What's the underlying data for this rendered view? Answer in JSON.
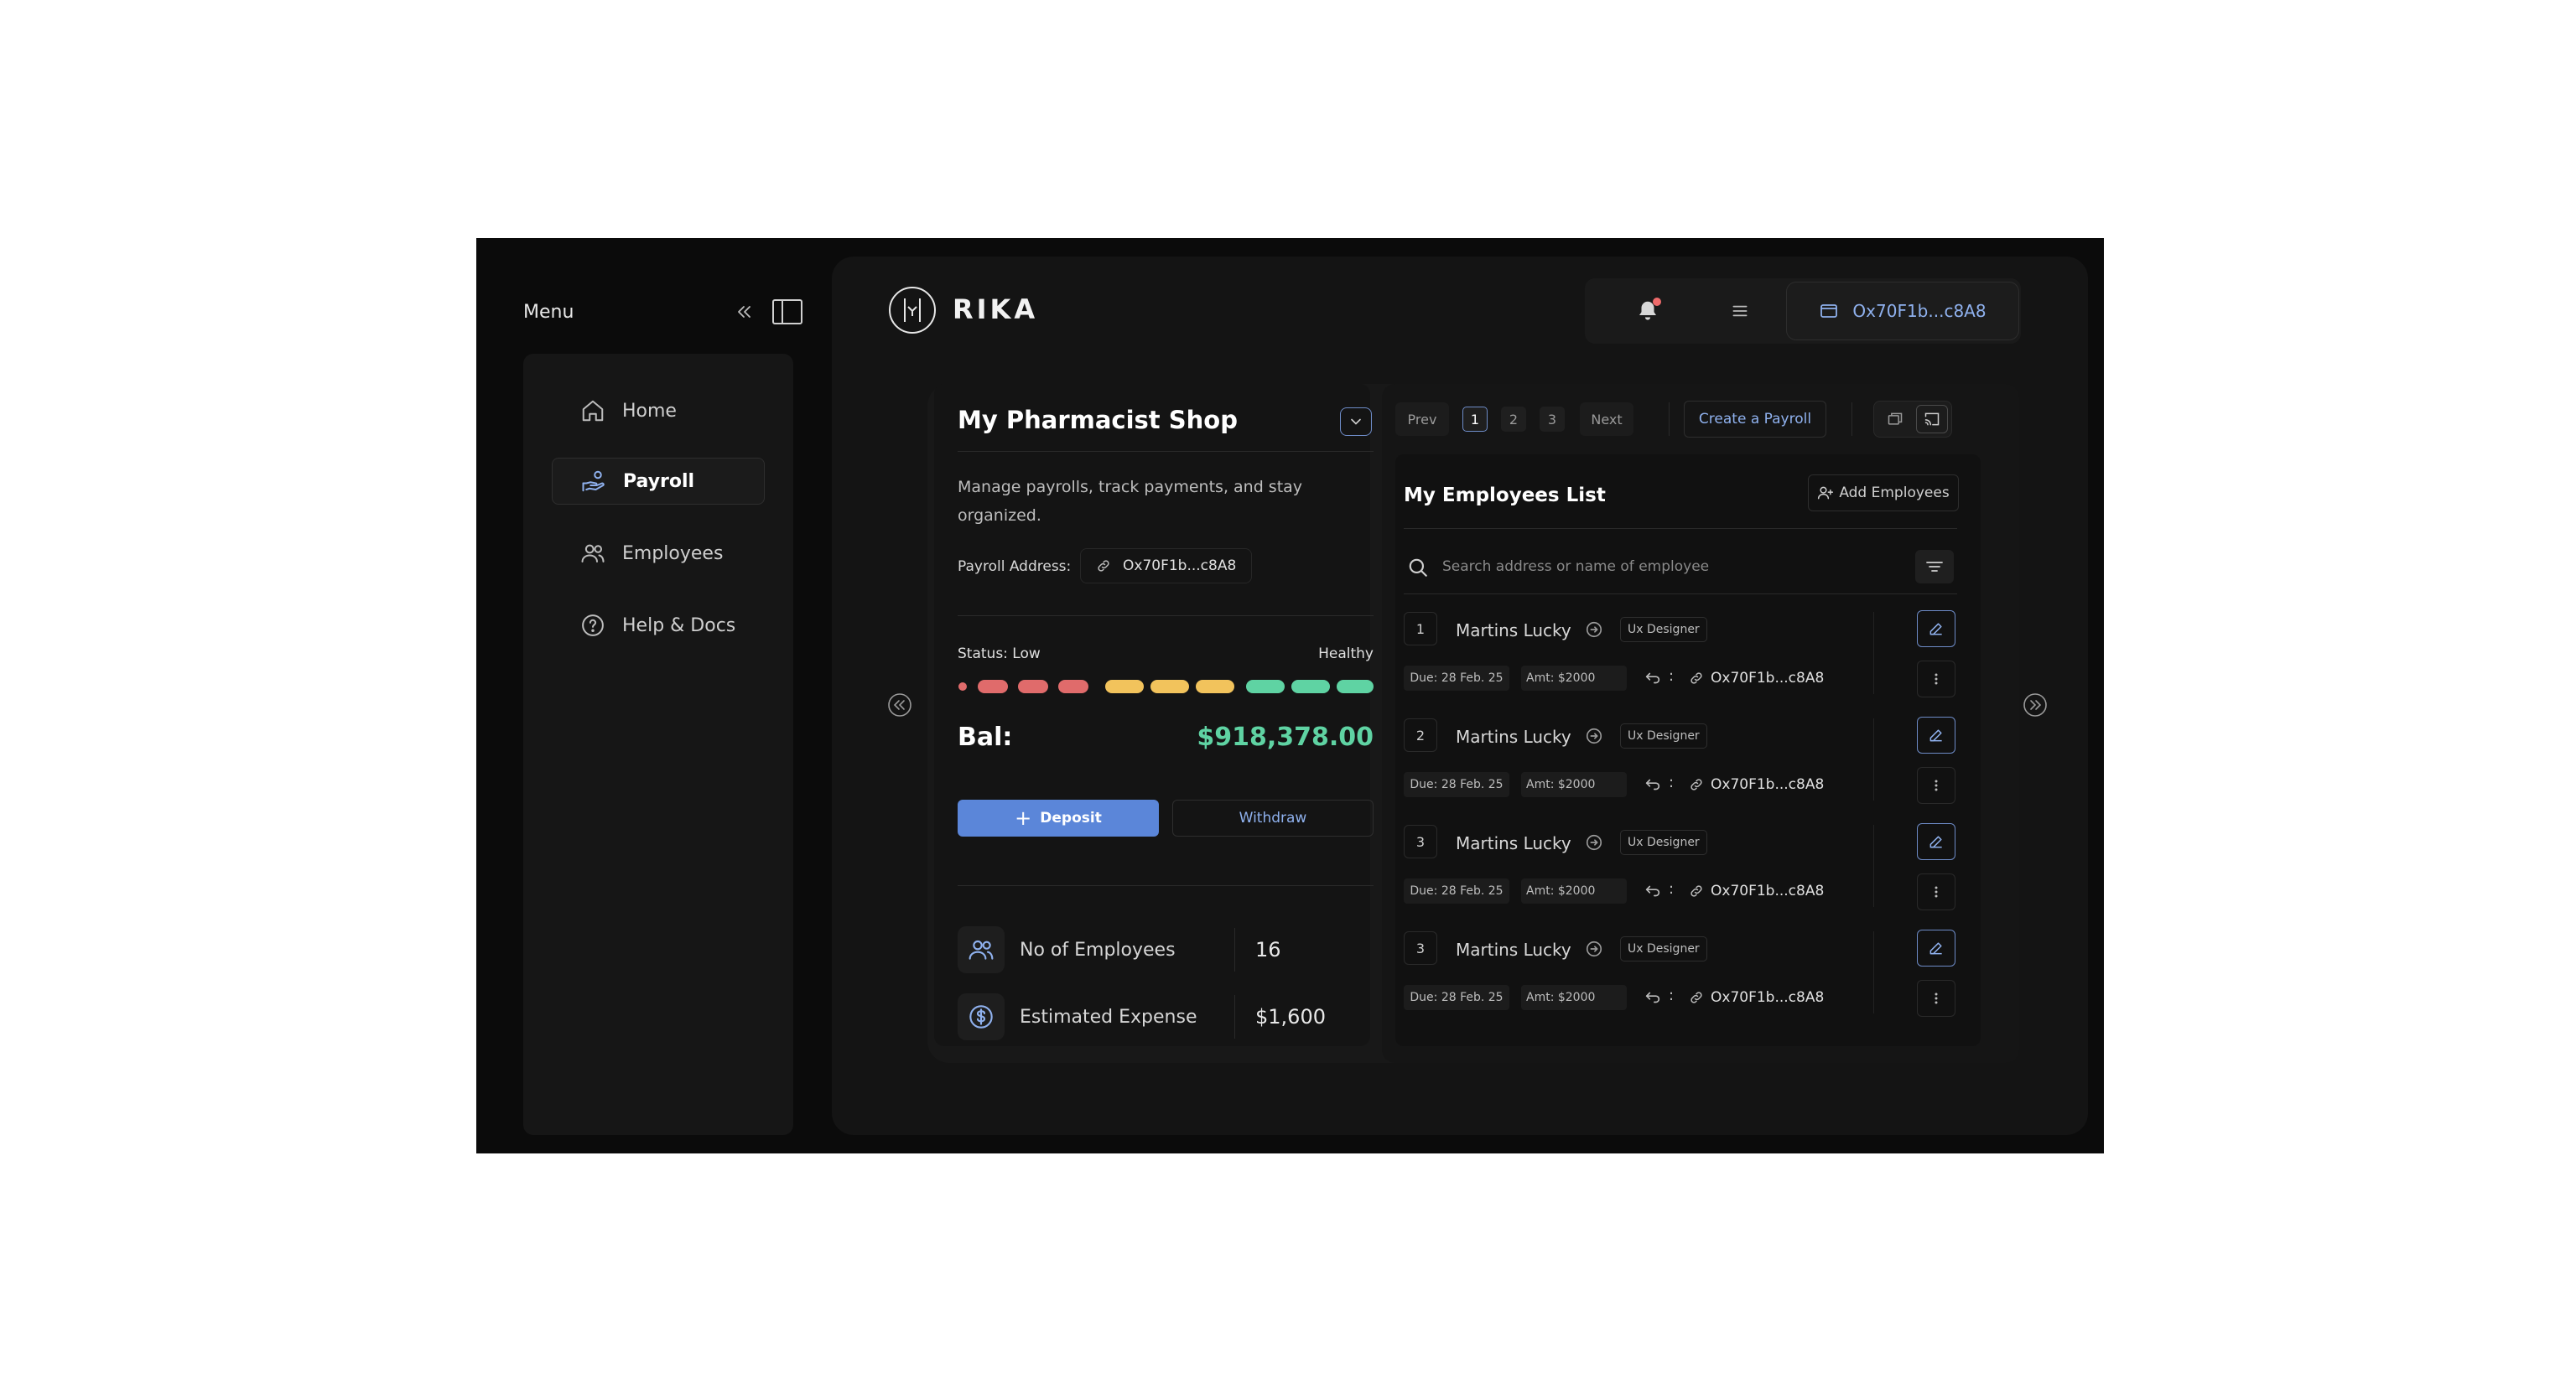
{
  "sidebar": {
    "title": "Menu",
    "items": [
      {
        "label": "Home",
        "icon": "home-icon",
        "active": false
      },
      {
        "label": "Payroll",
        "icon": "hand-coins-icon",
        "active": true
      },
      {
        "label": "Employees",
        "icon": "users-icon",
        "active": false
      },
      {
        "label": "Help & Docs",
        "icon": "help-circle-icon",
        "active": false
      }
    ]
  },
  "header": {
    "brand": "RIKA",
    "wallet": "Ox70F1b...c8A8"
  },
  "shop": {
    "title": "My Pharmacist Shop",
    "description": "Manage payrolls, track payments, and stay organized.",
    "address_label": "Payroll Address:",
    "address": "Ox70F1b...c8A8",
    "status_left": "Status: Low",
    "status_right": "Healthy",
    "balance_label": "Bal:",
    "balance": "$918,378.00",
    "deposit": "Deposit",
    "withdraw": "Withdraw",
    "stats": [
      {
        "label": "No of Employees",
        "value": "16"
      },
      {
        "label": "Estimated Expense",
        "value": "$1,600"
      }
    ],
    "colors": {
      "low": "#e06b6b",
      "mid": "#f2c35c",
      "healthy": "#5fd3a3",
      "accent": "#5b86d9"
    }
  },
  "employees": {
    "prev": "Prev",
    "next": "Next",
    "pages": [
      "1",
      "2",
      "3"
    ],
    "current_page": "1",
    "create_payroll": "Create a Payroll",
    "list_title": "My Employees List",
    "add_employees": "Add Employees",
    "search_placeholder": "Search address or name of employee",
    "rows": [
      {
        "num": "1",
        "name": "Martins Lucky",
        "role": "Ux Designer",
        "due": "Due: 28 Feb. 25",
        "amt": "Amt: $2000",
        "addr": "Ox70F1b...c8A8"
      },
      {
        "num": "2",
        "name": "Martins Lucky",
        "role": "Ux Designer",
        "due": "Due: 28 Feb. 25",
        "amt": "Amt: $2000",
        "addr": "Ox70F1b...c8A8"
      },
      {
        "num": "3",
        "name": "Martins Lucky",
        "role": "Ux Designer",
        "due": "Due: 28 Feb. 25",
        "amt": "Amt: $2000",
        "addr": "Ox70F1b...c8A8"
      },
      {
        "num": "3",
        "name": "Martins Lucky",
        "role": "Ux Designer",
        "due": "Due: 28 Feb. 25",
        "amt": "Amt: $2000",
        "addr": "Ox70F1b...c8A8"
      }
    ]
  }
}
